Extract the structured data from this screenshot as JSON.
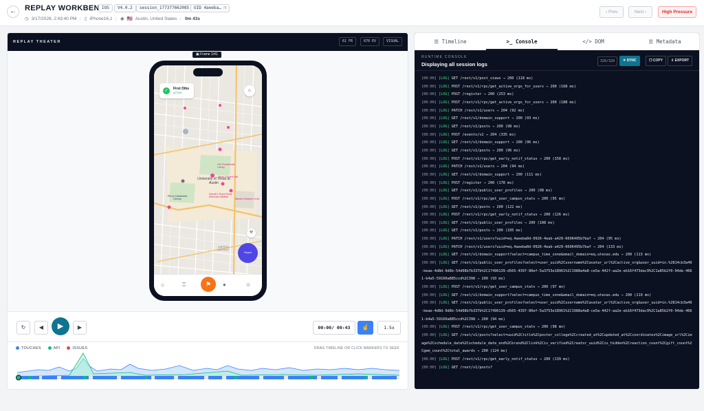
{
  "header": {
    "back_icon": "arrow-left-icon",
    "title": "REPLAY WORKBENCH",
    "platform": "IOS",
    "version": "V4.0.2",
    "session": "session_177377662085",
    "uid": "UID 4aeeba…",
    "datetime": "3/17/2026, 2:43:40 PM",
    "device": "iPhone16,1",
    "flag": "🇺🇸",
    "location": "Austin, United States",
    "duration": "0m 43s",
    "prev_label": "‹ Prev",
    "next_label": "Next ›",
    "pressure_label": "High Pressure"
  },
  "theater": {
    "label": "REPLAY THEATER",
    "fps": "61 FR",
    "events": "670 EV",
    "mode": "VISUAL",
    "frame_label": "Frame 1/41",
    "phone": {
      "first_dibs_name": "First Dibs",
      "first_dibs_status": "ACTIVE",
      "university_label": "University of Texas at Austin",
      "perry_label": "Perry-Castaneda Library",
      "pink_labels": [
        "LBJ Presidential Library",
        "Bass Concert Hall",
        "Darrell K Royal Texas Memorial Stadium",
        "Blanton Museum of Art"
      ],
      "capitol_label": "CAPITOL DISTRICT",
      "report_label": "Report"
    }
  },
  "controls": {
    "time": "00:00/ 00:43",
    "speed": "1.5x"
  },
  "timeline": {
    "legend": [
      {
        "label": "TOUCHES",
        "color": "#3b82f6"
      },
      {
        "label": "API",
        "color": "#10b981"
      },
      {
        "label": "ISSUES",
        "color": "#ef4444"
      }
    ],
    "hint": "DRAG TIMELINE OR CLICK MARKERS TO SEEK"
  },
  "tabs": [
    {
      "label": "Timeline",
      "icon": "list-icon"
    },
    {
      "label": "Console",
      "icon": "terminal-icon"
    },
    {
      "label": "DOM",
      "icon": "code-icon"
    },
    {
      "label": "Metadata",
      "icon": "database-icon"
    }
  ],
  "console": {
    "kicker": "RUNTIME CONSOLE",
    "title": "Displaying all session logs",
    "count": "320/320",
    "sync_label": "SYNC",
    "copy_label": "COPY",
    "export_label": "EXPORT",
    "logs": [
      {
        "ts": "[00:00]",
        "lvl": "[LOG]",
        "msg": "GET /rest/v1/post_views → 200 (118 ms)"
      },
      {
        "ts": "[00:00]",
        "lvl": "[LOG]",
        "msg": "POST /rest/v1/rpc/get_active_orgs_for_users → 200 (168 ms)"
      },
      {
        "ts": "[00:00]",
        "lvl": "[LOG]",
        "msg": "POST /register → 200 (253 ms)"
      },
      {
        "ts": "[00:00]",
        "lvl": "[LOG]",
        "msg": "POST /rest/v1/rpc/get_active_orgs_for_users → 200 (188 ms)"
      },
      {
        "ts": "[00:00]",
        "lvl": "[LOG]",
        "msg": "PATCH /rest/v1/users → 204 (92 ms)"
      },
      {
        "ts": "[00:00]",
        "lvl": "[LOG]",
        "msg": "GET /rest/v1/domain_support → 200 (93 ms)"
      },
      {
        "ts": "[00:00]",
        "lvl": "[LOG]",
        "msg": "GET /rest/v1/posts → 200 (98 ms)"
      },
      {
        "ts": "[00:00]",
        "lvl": "[LOG]",
        "msg": "POST /events/v2 → 204 (335 ms)"
      },
      {
        "ts": "[00:00]",
        "lvl": "[LOG]",
        "msg": "GET /rest/v1/domain_support → 200 (96 ms)"
      },
      {
        "ts": "[00:00]",
        "lvl": "[LOG]",
        "msg": "GET /rest/v1/posts → 200 (96 ms)"
      },
      {
        "ts": "[00:00]",
        "lvl": "[LOG]",
        "msg": "POST /rest/v1/rpc/get_early_notif_status → 200 (158 ms)"
      },
      {
        "ts": "[00:00]",
        "lvl": "[LOG]",
        "msg": "PATCH /rest/v1/users → 204 (94 ms)"
      },
      {
        "ts": "[00:00]",
        "lvl": "[LOG]",
        "msg": "GET /rest/v1/domain_support → 200 (111 ms)"
      },
      {
        "ts": "[00:00]",
        "lvl": "[LOG]",
        "msg": "POST /register → 200 (178 ms)"
      },
      {
        "ts": "[00:00]",
        "lvl": "[LOG]",
        "msg": "GET /rest/v1/public_user_profiles → 200 (98 ms)"
      },
      {
        "ts": "[00:00]",
        "lvl": "[LOG]",
        "msg": "POST /rest/v1/rpc/get_user_campus_stats → 200 (95 ms)"
      },
      {
        "ts": "[00:00]",
        "lvl": "[LOG]",
        "msg": "GET /rest/v1/posts → 200 (122 ms)"
      },
      {
        "ts": "[00:00]",
        "lvl": "[LOG]",
        "msg": "POST /rest/v1/rpc/get_early_notif_status → 200 (126 ms)"
      },
      {
        "ts": "[00:00]",
        "lvl": "[LOG]",
        "msg": "GET /rest/v1/public_user_profiles → 200 (108 ms)"
      },
      {
        "ts": "[00:00]",
        "lvl": "[LOG]",
        "msg": "GET /rest/v1/posts → 200 (105 ms)"
      },
      {
        "ts": "[00:00]",
        "lvl": "[LOG]",
        "msg": "PATCH /rest/v1/users?uuid=eq.4aeeba0d-0926-4eab-a429-6696495b7baf → 204 (95 ms)"
      },
      {
        "ts": "[00:00]",
        "lvl": "[LOG]",
        "msg": "PATCH /rest/v1/users?uuid=eq.4aeeba0d-0926-4eab-a429-6696495b7baf → 204 (133 ms)"
      },
      {
        "ts": "[00:00]",
        "lvl": "[LOG]",
        "msg": "GET /rest/v1/domain_support?select=campus_time_zone&email_domain=eq.utexas.edu → 200 (113 ms)"
      },
      {
        "ts": "[00:00]",
        "lvl": "[LOG]",
        "msg": "GET /rest/v1/public_user_profiles?select=user_uuid%2Cusername%2Cavatar_url%2Cactive_org&user_uuid=in.%2814cb3a40-beae-4d8d-9d6b-54d08b7b337b%2C174961​39-d565-4397-80ef-5a3753e18961%2C1988a4a8-ce5a-442f-aa2e-eb16f473dac9%2C1a85b2f0-94de-4661-b4a5-59160a885ccd%2C398 → 200 (93 ms)"
      },
      {
        "ts": "[00:00]",
        "lvl": "[LOG]",
        "msg": "POST /rest/v1/rpc/get_user_campus_stats → 200 (97 ms)"
      },
      {
        "ts": "[00:00]",
        "lvl": "[LOG]",
        "msg": "GET /rest/v1/domain_support?select=campus_time_zone&email_domain=eq.utexas.edu → 200 (119 ms)"
      },
      {
        "ts": "[00:00]",
        "lvl": "[LOG]",
        "msg": "GET /rest/v1/public_user_profiles?select=user_uuid%2Cusername%2Cavatar_url%2Cactive_org&user_uuid=in.%2814cb3a40-beae-4d8d-9d6b-54d08b7b337b%2C17496139-d565-4397-80ef-5a3753e18961%2C1988a4a8-ce5a-442f-aa2e-eb16f473dac9%2C1a85b2f0-94de-4661-b4a5-59160a885ccd%2C398 → 200 (94 ms)"
      },
      {
        "ts": "[00:00]",
        "lvl": "[LOG]",
        "msg": "POST /rest/v1/rpc/get_user_campus_stats → 200 (98 ms)"
      },
      {
        "ts": "[00:00]",
        "lvl": "[LOG]",
        "msg": "GET /rest/v1/posts?select=uuid%2Ctitle%2Cposter_college%2Ccreated_at%2Cupdated_at%2Ccoordinates%2Cimage_url%2Cimage%2Cschedule_date%2Cschedule_date_end%2Cbrand%2Clink%2Cis_verified%2Creator_uuid%2Cis_hidden%2Creaction_count%2Cgift_count%2Cgem_count%2Ctotal_awards → 200 (124 ms)"
      },
      {
        "ts": "[00:00]",
        "lvl": "[LOG]",
        "msg": "POST /rest/v1/rpc/get_early_notif_status → 200 (139 ms)"
      },
      {
        "ts": "[00:00]",
        "lvl": "[LOG]",
        "msg": "GET /rest/v1/posts?"
      }
    ]
  }
}
